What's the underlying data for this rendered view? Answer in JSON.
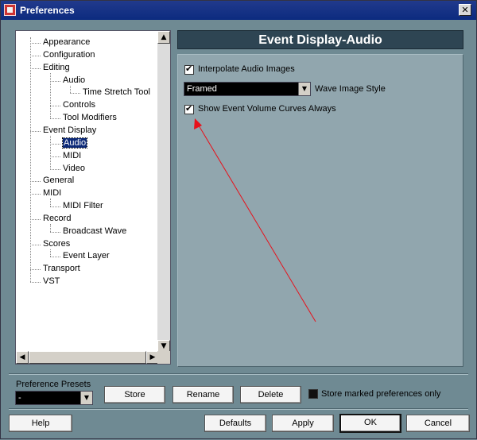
{
  "window": {
    "title": "Preferences",
    "close_glyph": "✕"
  },
  "tree": {
    "items": [
      {
        "label": "Appearance",
        "level": 0
      },
      {
        "label": "Configuration",
        "level": 0
      },
      {
        "label": "Editing",
        "level": 0
      },
      {
        "label": "Audio",
        "level": 1
      },
      {
        "label": "Time Stretch Tool",
        "level": 2
      },
      {
        "label": "Controls",
        "level": 1
      },
      {
        "label": "Tool Modifiers",
        "level": 1
      },
      {
        "label": "Event Display",
        "level": 0
      },
      {
        "label": "Audio",
        "level": 1,
        "selected": true
      },
      {
        "label": "MIDI",
        "level": 1
      },
      {
        "label": "Video",
        "level": 1
      },
      {
        "label": "General",
        "level": 0
      },
      {
        "label": "MIDI",
        "level": 0
      },
      {
        "label": "MIDI Filter",
        "level": 1
      },
      {
        "label": "Record",
        "level": 0
      },
      {
        "label": "Broadcast Wave",
        "level": 1
      },
      {
        "label": "Scores",
        "level": 0
      },
      {
        "label": "Event Layer",
        "level": 1
      },
      {
        "label": "Transport",
        "level": 0
      },
      {
        "label": "VST",
        "level": 0
      }
    ],
    "scroll_up_glyph": "▲",
    "scroll_down_glyph": "▼",
    "scroll_left_glyph": "◀",
    "scroll_right_glyph": "▶"
  },
  "panel": {
    "title": "Event Display-Audio",
    "interpolate_label": "Interpolate Audio Images",
    "interpolate_checked": true,
    "wave_style_value": "Framed",
    "wave_style_label": "Wave Image Style",
    "show_curves_label": "Show Event Volume Curves Always",
    "show_curves_checked": true,
    "arrow_color": "#e8101a"
  },
  "presets": {
    "label": "Preference Presets",
    "value": "-",
    "store": "Store",
    "rename": "Rename",
    "delete": "Delete",
    "store_marked_label": "Store marked preferences only",
    "store_marked_checked": false
  },
  "footer": {
    "help": "Help",
    "defaults": "Defaults",
    "apply": "Apply",
    "ok": "OK",
    "cancel": "Cancel"
  }
}
